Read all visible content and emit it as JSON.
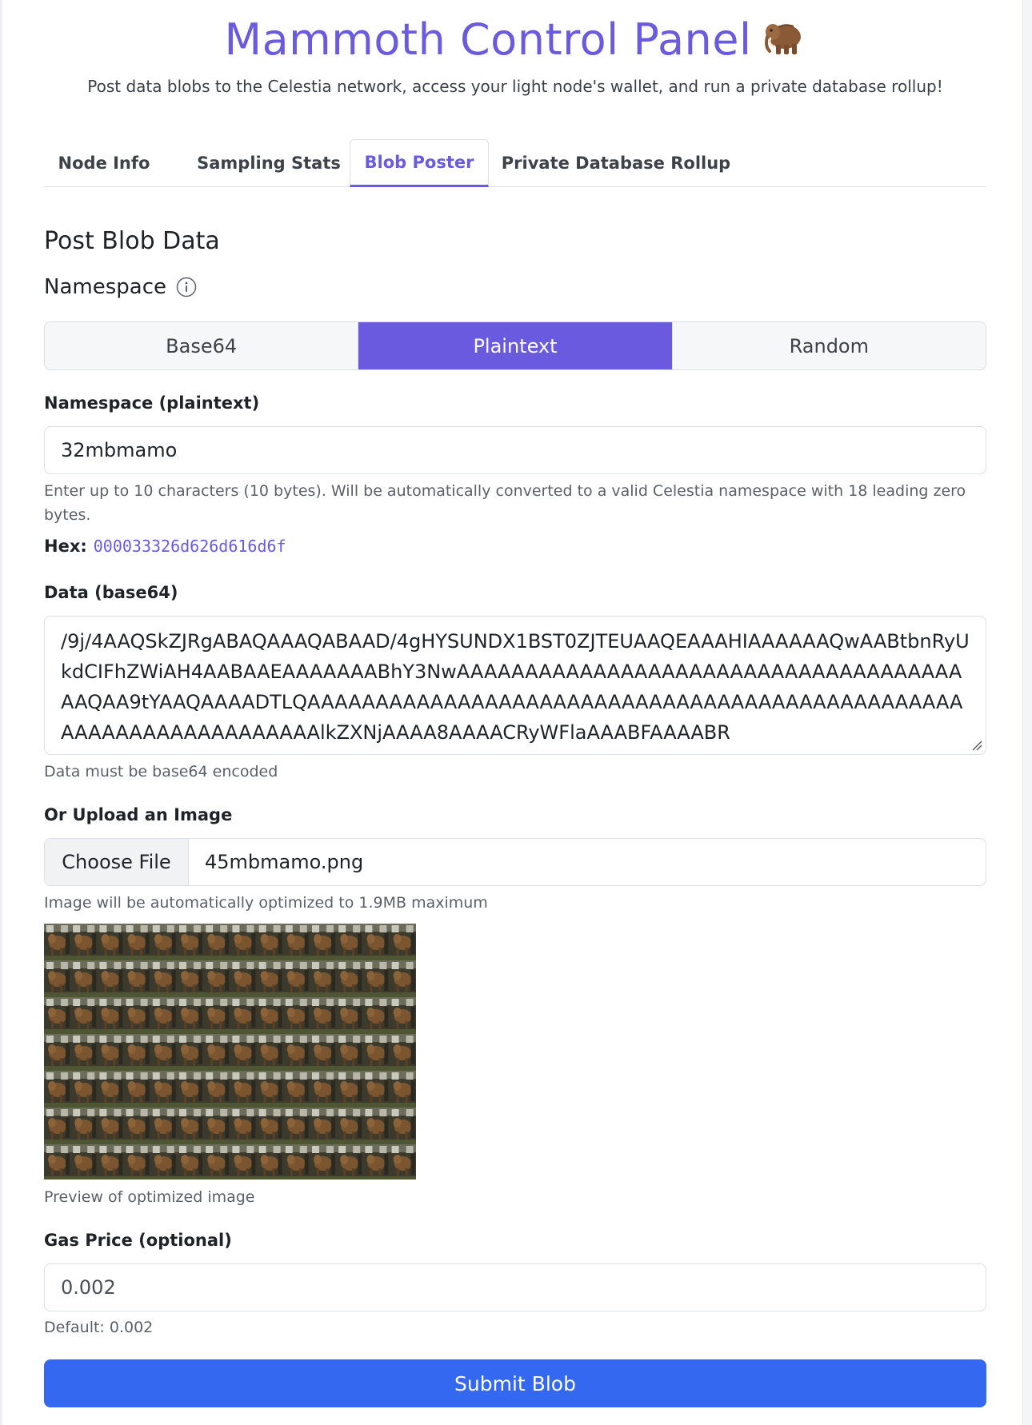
{
  "header": {
    "title": "Mammoth Control Panel",
    "emoji_icon": "mammoth-icon",
    "subtitle": "Post data blobs to the Celestia network, access your light node's wallet, and run a private database rollup!"
  },
  "tabs": [
    {
      "label": "Node Info",
      "active": false
    },
    {
      "label": "Sampling Stats",
      "active": false
    },
    {
      "label": "Blob Poster",
      "active": true
    },
    {
      "label": "Private Database Rollup",
      "active": false
    }
  ],
  "form": {
    "section_title": "Post Blob Data",
    "namespace_heading": "Namespace",
    "namespace_modes": [
      {
        "label": "Base64",
        "active": false
      },
      {
        "label": "Plaintext",
        "active": true
      },
      {
        "label": "Random",
        "active": false
      }
    ],
    "namespace_label": "Namespace (plaintext)",
    "namespace_value": "32mbmamo",
    "namespace_help": "Enter up to 10 characters (10 bytes). Will be automatically converted to a valid Celestia namespace with 18 leading zero bytes.",
    "hex_label": "Hex:",
    "hex_value": "000033326d626d616d6f",
    "data_label": "Data (base64)",
    "data_value": "/9j/4AAQSkZJRgABAQAAAQABAAD/4gHYSUNDX1BST0ZJTEUAAQEAAAHIAAAAAAQwAABtbnRyUkdCIFhZWiAH4AABAAEAAAAAAABhY3NwAAAAAAAAAAAAAAAAAAAAAAAAAAAAAAAAAAAAAAAQAA9tYAAQAAAADTLQAAAAAAAAAAAAAAAAAAAAAAAAAAAAAAAAAAAAAAAAAAAAAAAAAAAAAAAAAAAAAAAAAAAlkZXNjAAAA8AAAACRyWFlaAAABFAAAABR",
    "data_help": "Data must be base64 encoded",
    "upload_label": "Or Upload an Image",
    "file_button": "Choose File",
    "file_name": "45mbmamo.png",
    "upload_help": "Image will be automatically optimized to 1.9MB maximum",
    "preview_caption": "Preview of optimized image",
    "gas_label": "Gas Price (optional)",
    "gas_value": "0.002",
    "gas_help": "Default: 0.002",
    "submit_label": "Submit Blob"
  },
  "colors": {
    "accent": "#6a5ae0",
    "submit": "#3468f0"
  }
}
